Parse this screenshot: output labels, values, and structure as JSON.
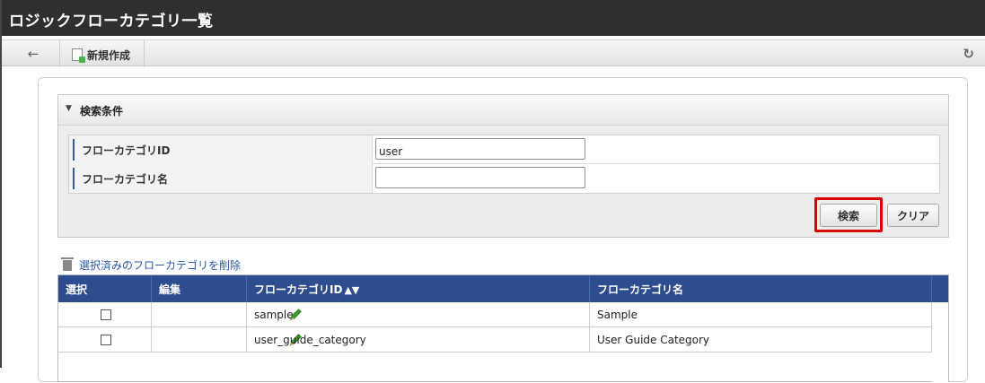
{
  "window": {
    "title": "ロジックフローカテゴリ一覧"
  },
  "toolbar": {
    "back_icon": "arrow-left",
    "new_label": "新規作成",
    "new_icon": "new-document-icon",
    "refresh_icon": "refresh"
  },
  "search": {
    "header_label": "検索条件",
    "fields": [
      {
        "label": "フローカテゴリID",
        "value": "user",
        "placeholder": ""
      },
      {
        "label": "フローカテゴリ名",
        "value": "",
        "placeholder": ""
      }
    ],
    "search_button": "検索",
    "clear_button": "クリア",
    "highlight_color": "#d90000"
  },
  "actions": {
    "delete_selected": "選択済みのフローカテゴリを削除"
  },
  "grid": {
    "headers": [
      "選択",
      "編集",
      "フローカテゴリID",
      "フローカテゴリ名"
    ],
    "sort_indicator": "▲▼",
    "header_color": "#2e4d8f",
    "rows": [
      {
        "id": "sample",
        "name": "Sample"
      },
      {
        "id": "user_guide_category",
        "name": "User Guide Category"
      }
    ]
  }
}
